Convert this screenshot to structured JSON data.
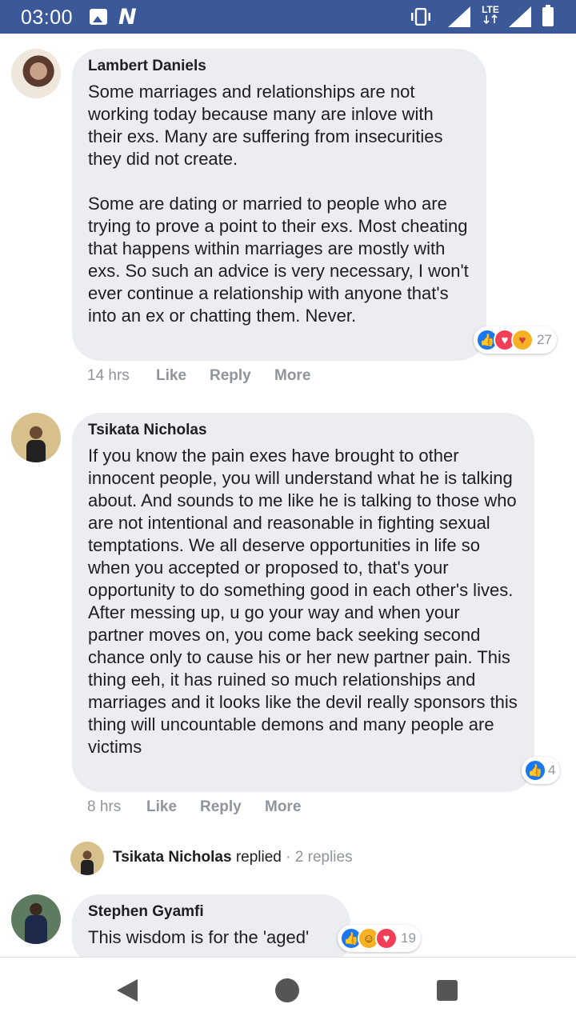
{
  "status_bar": {
    "time": "03:00",
    "network_label": "LTE",
    "icons": [
      "image-icon",
      "n-icon",
      "vibrate-icon",
      "signal-icon",
      "lte-icon",
      "signal-icon",
      "battery-icon"
    ]
  },
  "comments": [
    {
      "author": "Lambert Daniels",
      "text": "Some marriages and relationships are not working today because many are inlove with their exs. Many are suffering from insecurities they did not create.\n\nSome are dating or married to people who are trying to prove a point to their exs. Most cheating that happens within marriages are mostly with exs. So such an advice is very necessary, I won't ever continue a relationship with anyone that's into an ex or chatting them. Never.",
      "time": "14 hrs",
      "like_label": "Like",
      "reply_label": "Reply",
      "more_label": "More",
      "reaction_count": "27",
      "reactions": [
        "like",
        "love",
        "care"
      ]
    },
    {
      "author": "Tsikata Nicholas",
      "text": "If you know the pain exes have brought to other innocent people, you will understand what he is talking about. And sounds to me like he is talking to those who are not intentional and reasonable in fighting sexual temptations. We all deserve opportunities in life so when you accepted or proposed to, that's your opportunity to do something good in each other's lives. After messing up, u go your way and when your partner moves on, you come back seeking second chance only to cause his or her new partner pain. This thing eeh, it has ruined so much relationships and marriages and it looks like the devil really sponsors this thing will uncountable demons and many people are victims",
      "time": "8 hrs",
      "like_label": "Like",
      "reply_label": "Reply",
      "more_label": "More",
      "reaction_count": "4",
      "reactions": [
        "like"
      ]
    },
    {
      "author": "Stephen Gyamfi",
      "text": "This wisdom is for the 'aged'",
      "reaction_count": "19",
      "reactions": [
        "like",
        "haha",
        "love"
      ]
    }
  ],
  "reply_summary": {
    "author": "Tsikata Nicholas",
    "verb": "replied",
    "separator": "·",
    "count_text": "2 replies"
  },
  "colors": {
    "status_bar": "#3b5998",
    "bubble": "#ebedf0",
    "like_blue": "#1877f2",
    "love_red": "#f33e58",
    "muted": "#90949c"
  }
}
